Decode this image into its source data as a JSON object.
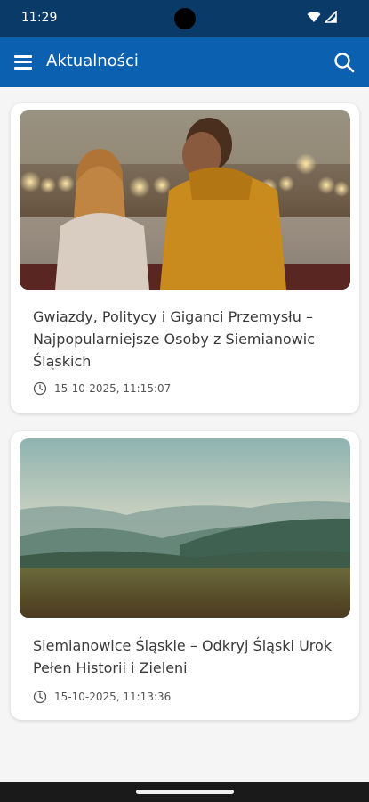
{
  "status_bar": {
    "time": "11:29"
  },
  "app_bar": {
    "title": "Aktualności",
    "menu_icon": "hamburger-menu-icon",
    "search_icon": "search-icon"
  },
  "articles": [
    {
      "title": "Gwiazdy, Politycy i Giganci Przemysłu – Najpopularniejsze Osoby z Siemianowic Śląskich",
      "date": "15-10-2025, 11:15:07",
      "image": "couple-at-christmas-market-photo"
    },
    {
      "title": "Siemianowice Śląskie – Odkryj Śląski Urok Pełen Historii i Zieleni",
      "date": "15-10-2025, 11:13:36",
      "image": "misty-hills-landscape-photo"
    }
  ],
  "colors": {
    "status_bar": "#0a3a67",
    "app_bar": "#0b60b0",
    "card_bg": "#ffffff",
    "page_bg": "#f5f5f5"
  }
}
